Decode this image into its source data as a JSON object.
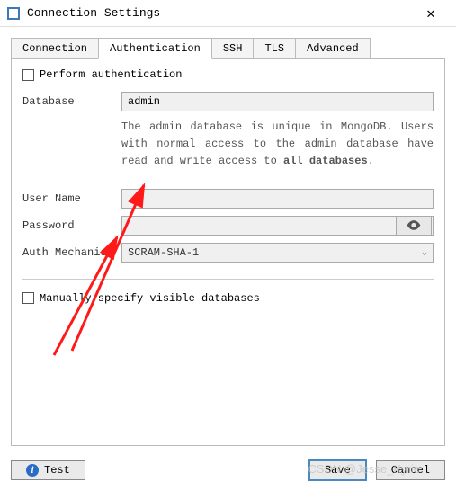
{
  "title": "Connection Settings",
  "tabs": {
    "connection": "Connection",
    "authentication": "Authentication",
    "ssh": "SSH",
    "tls": "TLS",
    "advanced": "Advanced"
  },
  "auth": {
    "perform_label": "Perform authentication",
    "database_label": "Database",
    "database_value": "admin",
    "help_pre": "The admin database is unique in MongoDB. Users with normal access to the admin database have read and write access to ",
    "help_bold": "all databases",
    "username_label": "User Name",
    "username_value": "",
    "password_label": "Password",
    "password_value": "",
    "mechanism_label": "Auth Mechanism",
    "mechanism_value": "SCRAM-SHA-1",
    "manual_label": "Manually specify visible databases"
  },
  "buttons": {
    "test": "Test",
    "save": "Save",
    "cancel": "Cancel"
  },
  "watermark": "CSDN @Jesse_Kyrie"
}
